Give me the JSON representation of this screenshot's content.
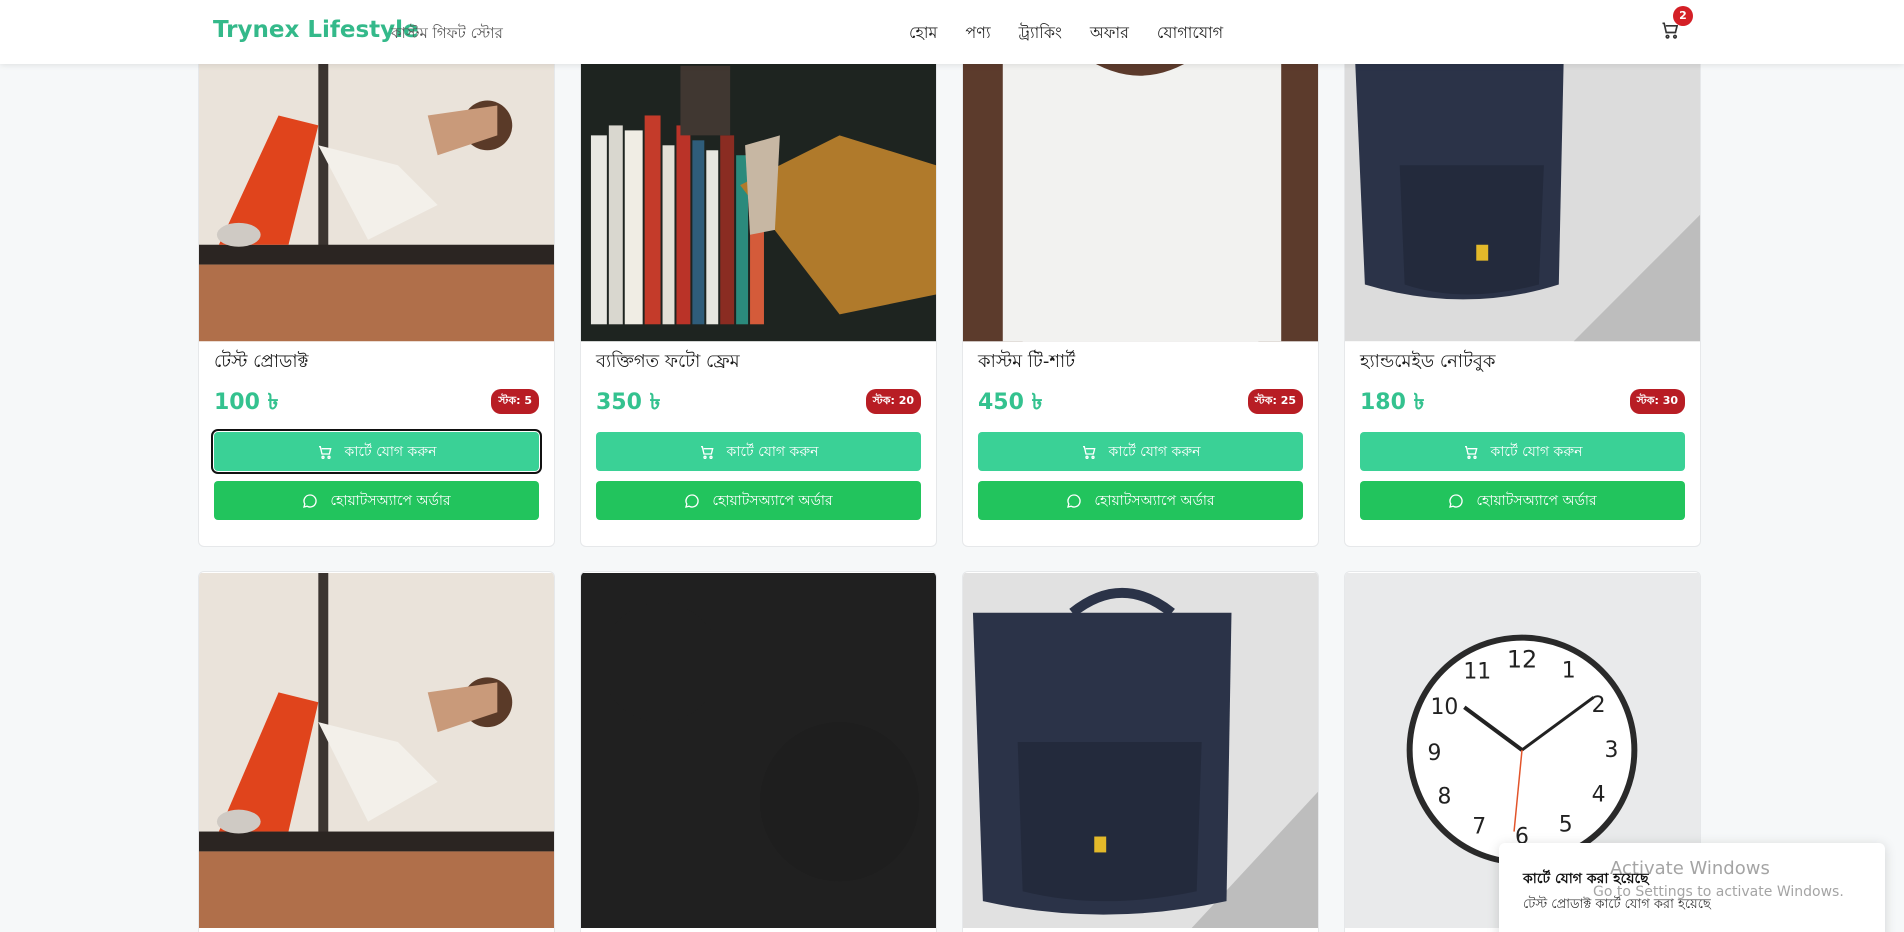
{
  "header": {
    "brand": "Trynex Lifestyle",
    "tagline": "কাস্টম গিফট স্টোর",
    "nav": [
      "হোম",
      "পণ্য",
      "ট্র্যাকিং",
      "অফার",
      "যোগাযোগ"
    ],
    "cart_count": "2"
  },
  "products": [
    {
      "title": "টেস্ট প্রোডাক্ট",
      "price": "100 ৳",
      "stock": "স্টক: 5",
      "add_to_cart": "কার্টে যোগ করুন",
      "whatsapp": "হোয়াটসঅ্যাপে অর্ডার",
      "image": "woman doing sit-ups"
    },
    {
      "title": "ব্যক্তিগত ফটো ফ্রেম",
      "price": "350 ৳",
      "stock": "স্টক: 20",
      "add_to_cart": "কার্টে যোগ করুন",
      "whatsapp": "হোয়াটসঅ্যাপে অর্ডার",
      "image": "bookshelf"
    },
    {
      "title": "কাস্টম টি-শার্ট",
      "price": "450 ৳",
      "stock": "স্টক: 25",
      "add_to_cart": "কার্টে যোগ করুন",
      "whatsapp": "হোয়াটসঅ্যাপে অর্ডার",
      "image": "white t-shirt"
    },
    {
      "title": "হ্যান্ডমেইড নোটবুক",
      "price": "180 ৳",
      "stock": "স্টক: 30",
      "add_to_cart": "কার্টে যোগ করুন",
      "whatsapp": "হোয়াটসঅ্যাপে অর্ডার",
      "image": "navy backpack"
    },
    {
      "image": "woman doing sit-ups"
    },
    {
      "image": "dark texture"
    },
    {
      "image": "navy backpack"
    },
    {
      "image": "wall clock"
    }
  ],
  "toast": {
    "title": "কার্টে যোগ করা হয়েছে",
    "message": "টেস্ট প্রোডাক্ট কার্টে যোগ করা হয়েছে"
  },
  "watermark": {
    "line1": "Activate Windows",
    "line2": "Go to Settings to activate Windows."
  },
  "colors": {
    "brand": "#34b98a",
    "cart_btn": "#3ad196",
    "wa_btn": "#22c45d",
    "stock_badge": "#b81d24",
    "cart_badge": "#d41f26"
  }
}
